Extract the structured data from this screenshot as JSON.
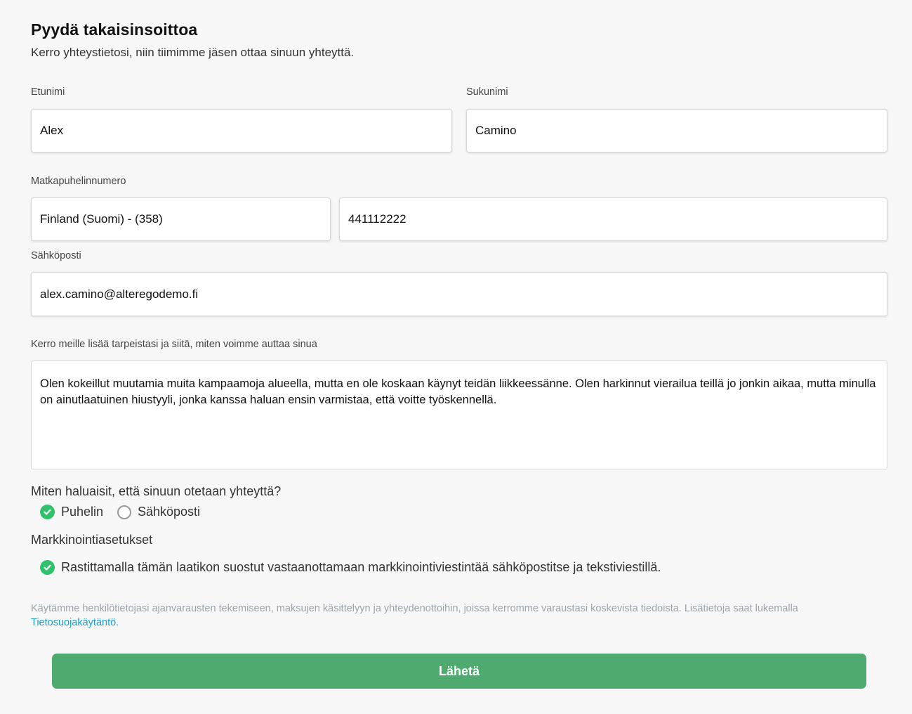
{
  "header": {
    "title": "Pyydä takaisinsoittoa",
    "subtitle": "Kerro yhteystietosi, niin tiimimme jäsen ottaa sinuun yhteyttä."
  },
  "form": {
    "first_name": {
      "label": "Etunimi",
      "value": "Alex"
    },
    "last_name": {
      "label": "Sukunimi",
      "value": "Camino"
    },
    "phone": {
      "label": "Matkapuhelinnumero",
      "country_value": "Finland (Suomi) - (358)",
      "number_value": "441112222"
    },
    "email": {
      "label": "Sähköposti",
      "value": "alex.camino@alteregodemo.fi"
    },
    "message": {
      "label": "Kerro meille lisää tarpeistasi ja siitä, miten voimme auttaa sinua",
      "value": "Olen kokeillut muutamia muita kampaamoja alueella, mutta en ole koskaan käynyt teidän liikkeessänne. Olen harkinnut vierailua teillä jo jonkin aikaa, mutta minulla on ainutlaatuinen hiustyyli, jonka kanssa haluan ensin varmistaa, että voitte työskennellä."
    },
    "contact_method": {
      "question": "Miten haluaisit, että sinuun otetaan yhteyttä?",
      "options": [
        {
          "label": "Puhelin",
          "selected": true
        },
        {
          "label": "Sähköposti",
          "selected": false
        }
      ]
    },
    "marketing": {
      "heading": "Markkinointiasetukset",
      "checkbox_label": "Rastittamalla tämän laatikon suostut vastaanottamaan markkinointiviestintää sähköpostitse ja tekstiviestillä.",
      "checked": true
    },
    "privacy": {
      "text": "Käytämme henkilötietojasi ajanvarausten tekemiseen, maksujen käsittelyyn ja yhteydenottoihin, joissa kerromme varaustasi koskevista tiedoista. Lisätietoja saat lukemalla ",
      "link_text": "Tietosuojakäytäntö."
    },
    "submit_label": "Lähetä"
  },
  "colors": {
    "accent_green": "#4faa6f",
    "check_green": "#2fc26b",
    "link_blue": "#1a9ec9"
  },
  "icons": {
    "checked": "check-circle-icon",
    "unchecked": "empty-circle-icon"
  }
}
